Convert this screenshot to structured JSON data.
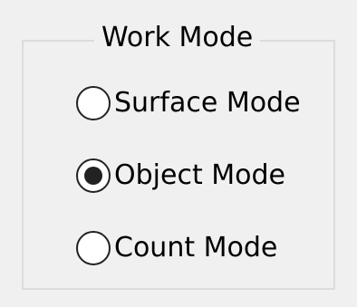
{
  "group": {
    "title": "Work Mode"
  },
  "options": [
    {
      "label": "Surface Mode",
      "checked": false
    },
    {
      "label": "Object Mode",
      "checked": true
    },
    {
      "label": "Count Mode",
      "checked": false
    }
  ]
}
